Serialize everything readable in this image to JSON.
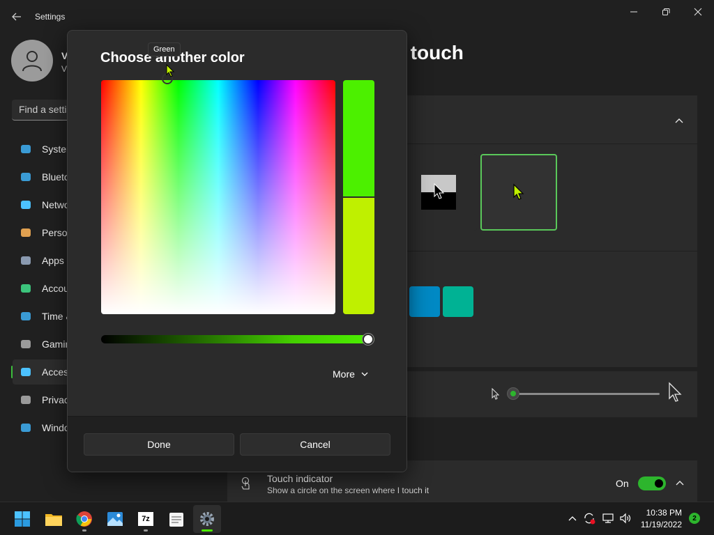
{
  "window": {
    "title": "Settings"
  },
  "user": {
    "name": "V",
    "email": "V"
  },
  "search": {
    "placeholder": "Find a setting"
  },
  "sidebar": {
    "items": [
      {
        "label": "System",
        "icon": "system-icon"
      },
      {
        "label": "Bluetooth & devices",
        "icon": "bluetooth-icon"
      },
      {
        "label": "Network & internet",
        "icon": "network-icon"
      },
      {
        "label": "Personalization",
        "icon": "brush-icon"
      },
      {
        "label": "Apps",
        "icon": "apps-icon"
      },
      {
        "label": "Accounts",
        "icon": "account-icon"
      },
      {
        "label": "Time & language",
        "icon": "clock-icon"
      },
      {
        "label": "Gaming",
        "icon": "gamepad-icon"
      },
      {
        "label": "Accessibility",
        "icon": "accessibility-icon",
        "active": true
      },
      {
        "label": "Privacy & security",
        "icon": "shield-icon"
      },
      {
        "label": "Windows Update",
        "icon": "update-icon"
      }
    ]
  },
  "page": {
    "title": "Mouse pointer and touch"
  },
  "pointer_colors": {
    "swatch_1": "#0089c4",
    "swatch_2": "#00b294",
    "selected_custom": "#bff000"
  },
  "pointer_size": {
    "level": 0.0
  },
  "touch": {
    "title": "Touch indicator",
    "subtitle": "Show a circle on the screen where I touch it",
    "toggle_label": "On",
    "enabled": true
  },
  "dialog": {
    "title": "Choose another color",
    "tooltip": "Green",
    "new_color": "#4cf000",
    "old_color": "#bff000",
    "more_label": "More",
    "done_label": "Done",
    "cancel_label": "Cancel",
    "value_level": 1.0
  },
  "taskbar": {
    "apps": [
      {
        "name": "start",
        "icon": "windows-start-icon"
      },
      {
        "name": "file-explorer",
        "icon": "folder-icon"
      },
      {
        "name": "chrome",
        "icon": "chrome-icon"
      },
      {
        "name": "photos",
        "icon": "photos-icon"
      },
      {
        "name": "7-zip",
        "icon": "7zip-icon",
        "label": "7z"
      },
      {
        "name": "notepad",
        "icon": "notepad-icon"
      },
      {
        "name": "settings",
        "icon": "gear-icon",
        "active": true
      }
    ],
    "time": "10:38 PM",
    "date": "11/19/2022",
    "notifications": "2"
  }
}
